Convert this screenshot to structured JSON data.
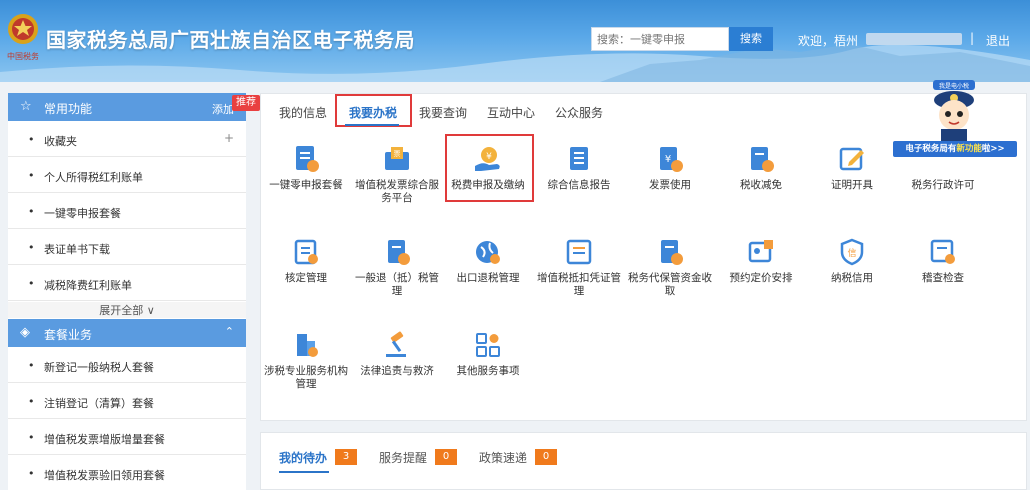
{
  "header": {
    "emblem_caption": "中国税务",
    "site_title": "国家税务总局广西壮族自治区电子税务局",
    "search_placeholder": "搜索：一键零申报",
    "search_button": "搜索",
    "welcome": "欢迎，梧州",
    "separator": "|",
    "logout": "退出"
  },
  "sidebar": {
    "recommend_badge": "推荐",
    "common": {
      "title": "常用功能",
      "add_label": "添加",
      "items": [
        "收藏夹",
        "个人所得税红利账单",
        "一键零申报套餐",
        "表证单书下载",
        "减税降费红利账单"
      ],
      "expand_label": "展开全部 ∨"
    },
    "package": {
      "title": "套餐业务",
      "items": [
        "新登记一般纳税人套餐",
        "注销登记（清算）套餐",
        "增值税发票增版增量套餐",
        "增值税发票验旧领用套餐"
      ]
    }
  },
  "main": {
    "tabs": [
      "我的信息",
      "我要办税",
      "我要查询",
      "互动中心",
      "公众服务"
    ],
    "active_tab": "我要办税",
    "services_row1": [
      "一键零申报套餐",
      "增值税发票综合服务平台",
      "税费申报及缴纳",
      "综合信息报告",
      "发票使用",
      "税收减免",
      "证明开具",
      "税务行政许可"
    ],
    "services_row2": [
      "核定管理",
      "一般退（抵）税管理",
      "出口退税管理",
      "增值税抵扣凭证管理",
      "税务代保管资金收取",
      "预约定价安排",
      "纳税信用",
      "稽查检查"
    ],
    "services_row3": [
      "涉税专业服务机构管理",
      "法律追责与救济",
      "其他服务事项"
    ],
    "icon_glyphs": {
      "invoice": "票",
      "tax": "¥",
      "credit": "信"
    }
  },
  "mascot": {
    "cap_text": "我是电小税",
    "banner_prefix": "电子税务局有",
    "banner_highlight": "新功能",
    "banner_suffix": "啦>>"
  },
  "bottom": {
    "tabs": [
      {
        "label": "我的待办",
        "count": "3"
      },
      {
        "label": "服务提醒",
        "count": "0"
      },
      {
        "label": "政策速递",
        "count": "0"
      }
    ]
  },
  "colors": {
    "accent": "#2b74c8",
    "highlight_box": "#e03a3a",
    "count_badge": "#f07a1c",
    "sidebar_head": "#5a9be0"
  }
}
